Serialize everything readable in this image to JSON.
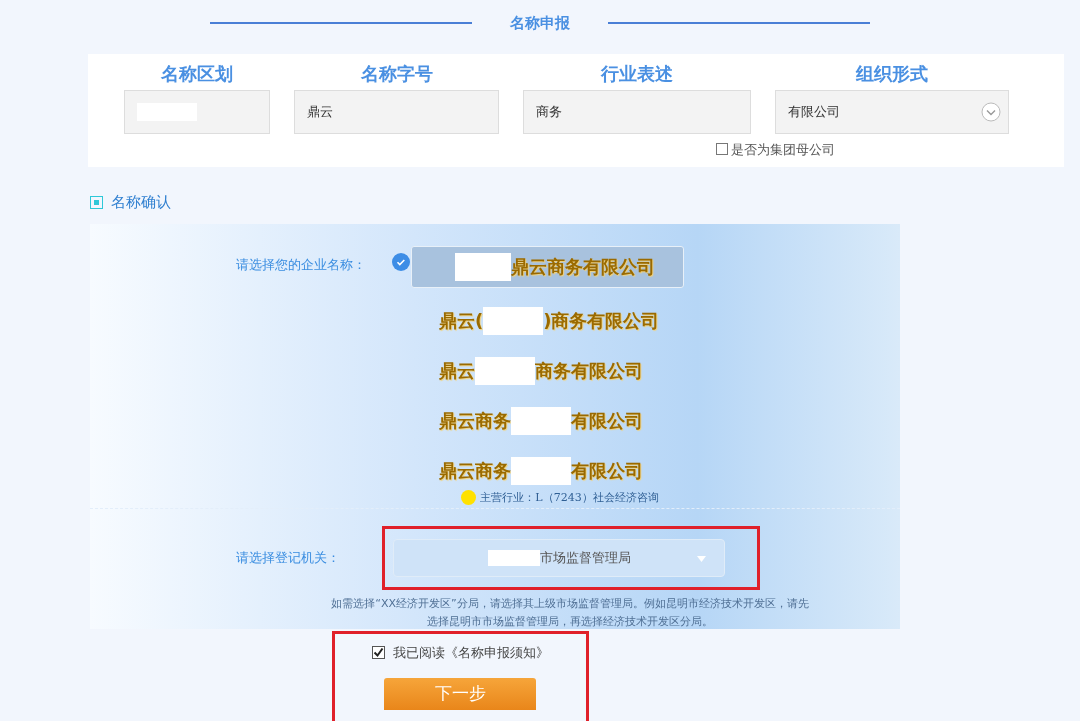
{
  "title": "名称申报",
  "fields": [
    {
      "label": "名称区划",
      "redacted": true,
      "kind": "text"
    },
    {
      "label": "名称字号",
      "value": "鼎云",
      "redacted": false,
      "kind": "text"
    },
    {
      "label": "行业表述",
      "value": "商务",
      "redacted": false,
      "kind": "text"
    },
    {
      "label": "组织形式",
      "value": "有限公司",
      "redacted": false,
      "kind": "select"
    }
  ],
  "group_parent": {
    "label": "是否为集团母公司",
    "checked": false
  },
  "section": "名称确认",
  "name_prompt": "请选择您的企业名称：",
  "name_options": [
    {
      "after": "鼎云商务有限公司",
      "selected": true
    },
    {
      "before": "鼎云(",
      "after": ")商务有限公司",
      "selected": false
    },
    {
      "before": "鼎云",
      "after": "商务有限公司",
      "selected": false
    },
    {
      "before": "鼎云商务",
      "after": "有限公司",
      "selected": false
    },
    {
      "before": "鼎云商务",
      "after": "有限公司",
      "selected": false
    }
  ],
  "industry": "主营行业：L（7243）社会经济咨询",
  "authority_prompt": "请选择登记机关：",
  "authority_value": "市场监督管理局",
  "notice": "如需选择“XX经济开发区”分局，请选择其上级市场监督管理局。例如昆明市经济技术开发区，请先选择昆明市市场监督管理局，再选择经济技术开发区分局。",
  "agreement": {
    "label": "我已阅读《名称申报须知》",
    "checked": true
  },
  "next_button": "下一步"
}
